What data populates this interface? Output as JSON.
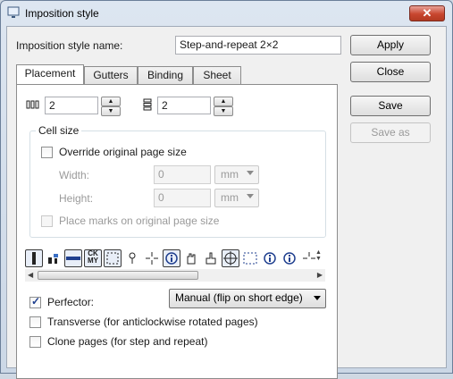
{
  "window": {
    "title": "Imposition style"
  },
  "style_name": {
    "label": "Imposition style name:",
    "value": "Step-and-repeat 2×2"
  },
  "buttons": {
    "apply": "Apply",
    "close": "Close",
    "save": "Save",
    "save_as": "Save as"
  },
  "tabs": [
    {
      "label": "Placement",
      "active": true
    },
    {
      "label": "Gutters",
      "active": false
    },
    {
      "label": "Binding",
      "active": false
    },
    {
      "label": "Sheet",
      "active": false
    }
  ],
  "placement": {
    "columns": {
      "icon": "columns-icon",
      "value": "2"
    },
    "rows": {
      "icon": "rows-icon",
      "value": "2"
    }
  },
  "cell_size": {
    "title": "Cell size",
    "override_label": "Override original page size",
    "override_checked": false,
    "width_label": "Width:",
    "width_value": "0",
    "width_unit": "mm",
    "height_label": "Height:",
    "height_value": "0",
    "height_unit": "mm",
    "place_marks_label": "Place marks on original page size",
    "place_marks_checked": false
  },
  "toolbar": {
    "icons": [
      "crop-marks-icon",
      "registration-icon",
      "fold-marks-icon",
      "cmyk-marks-icon",
      "dashed-frame-icon",
      "pin-icon",
      "crosshair-icon",
      "info-icon",
      "hand-icon",
      "hand-point-icon",
      "target-icon",
      "dashed-box-icon",
      "info-circle-icon",
      "info-circle-2-icon",
      "cross-icon"
    ],
    "cmyk_text": "CK MY"
  },
  "options": {
    "perfector_label": "Perfector:",
    "perfector_checked": true,
    "perfector_mode": "Manual (flip on short edge)",
    "transverse_label": "Transverse (for anticlockwise rotated pages)",
    "transverse_checked": false,
    "clone_label": "Clone pages (for step and repeat)",
    "clone_checked": false
  },
  "colors": {
    "close_button": "#c8462f",
    "panel_bg": "#ffffff",
    "dialog_bg": "#f0f0f0",
    "accent": "#1f3f8f"
  }
}
